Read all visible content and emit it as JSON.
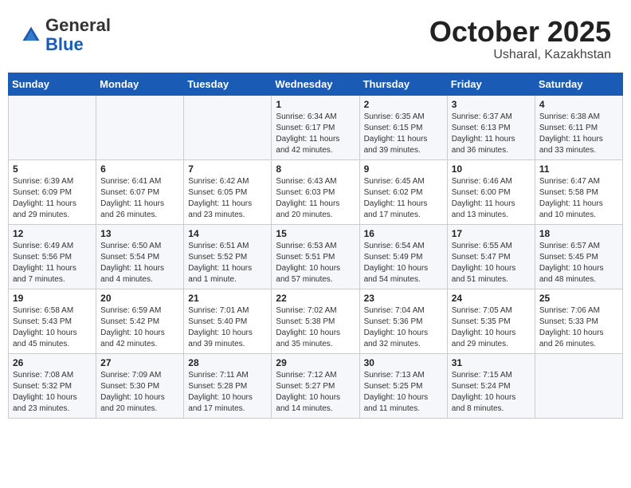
{
  "header": {
    "logo_line1": "General",
    "logo_line2": "Blue",
    "month": "October 2025",
    "location": "Usharal, Kazakhstan"
  },
  "weekdays": [
    "Sunday",
    "Monday",
    "Tuesday",
    "Wednesday",
    "Thursday",
    "Friday",
    "Saturday"
  ],
  "weeks": [
    [
      {
        "day": "",
        "content": ""
      },
      {
        "day": "",
        "content": ""
      },
      {
        "day": "",
        "content": ""
      },
      {
        "day": "1",
        "content": "Sunrise: 6:34 AM\nSunset: 6:17 PM\nDaylight: 11 hours\nand 42 minutes."
      },
      {
        "day": "2",
        "content": "Sunrise: 6:35 AM\nSunset: 6:15 PM\nDaylight: 11 hours\nand 39 minutes."
      },
      {
        "day": "3",
        "content": "Sunrise: 6:37 AM\nSunset: 6:13 PM\nDaylight: 11 hours\nand 36 minutes."
      },
      {
        "day": "4",
        "content": "Sunrise: 6:38 AM\nSunset: 6:11 PM\nDaylight: 11 hours\nand 33 minutes."
      }
    ],
    [
      {
        "day": "5",
        "content": "Sunrise: 6:39 AM\nSunset: 6:09 PM\nDaylight: 11 hours\nand 29 minutes."
      },
      {
        "day": "6",
        "content": "Sunrise: 6:41 AM\nSunset: 6:07 PM\nDaylight: 11 hours\nand 26 minutes."
      },
      {
        "day": "7",
        "content": "Sunrise: 6:42 AM\nSunset: 6:05 PM\nDaylight: 11 hours\nand 23 minutes."
      },
      {
        "day": "8",
        "content": "Sunrise: 6:43 AM\nSunset: 6:03 PM\nDaylight: 11 hours\nand 20 minutes."
      },
      {
        "day": "9",
        "content": "Sunrise: 6:45 AM\nSunset: 6:02 PM\nDaylight: 11 hours\nand 17 minutes."
      },
      {
        "day": "10",
        "content": "Sunrise: 6:46 AM\nSunset: 6:00 PM\nDaylight: 11 hours\nand 13 minutes."
      },
      {
        "day": "11",
        "content": "Sunrise: 6:47 AM\nSunset: 5:58 PM\nDaylight: 11 hours\nand 10 minutes."
      }
    ],
    [
      {
        "day": "12",
        "content": "Sunrise: 6:49 AM\nSunset: 5:56 PM\nDaylight: 11 hours\nand 7 minutes."
      },
      {
        "day": "13",
        "content": "Sunrise: 6:50 AM\nSunset: 5:54 PM\nDaylight: 11 hours\nand 4 minutes."
      },
      {
        "day": "14",
        "content": "Sunrise: 6:51 AM\nSunset: 5:52 PM\nDaylight: 11 hours\nand 1 minute."
      },
      {
        "day": "15",
        "content": "Sunrise: 6:53 AM\nSunset: 5:51 PM\nDaylight: 10 hours\nand 57 minutes."
      },
      {
        "day": "16",
        "content": "Sunrise: 6:54 AM\nSunset: 5:49 PM\nDaylight: 10 hours\nand 54 minutes."
      },
      {
        "day": "17",
        "content": "Sunrise: 6:55 AM\nSunset: 5:47 PM\nDaylight: 10 hours\nand 51 minutes."
      },
      {
        "day": "18",
        "content": "Sunrise: 6:57 AM\nSunset: 5:45 PM\nDaylight: 10 hours\nand 48 minutes."
      }
    ],
    [
      {
        "day": "19",
        "content": "Sunrise: 6:58 AM\nSunset: 5:43 PM\nDaylight: 10 hours\nand 45 minutes."
      },
      {
        "day": "20",
        "content": "Sunrise: 6:59 AM\nSunset: 5:42 PM\nDaylight: 10 hours\nand 42 minutes."
      },
      {
        "day": "21",
        "content": "Sunrise: 7:01 AM\nSunset: 5:40 PM\nDaylight: 10 hours\nand 39 minutes."
      },
      {
        "day": "22",
        "content": "Sunrise: 7:02 AM\nSunset: 5:38 PM\nDaylight: 10 hours\nand 35 minutes."
      },
      {
        "day": "23",
        "content": "Sunrise: 7:04 AM\nSunset: 5:36 PM\nDaylight: 10 hours\nand 32 minutes."
      },
      {
        "day": "24",
        "content": "Sunrise: 7:05 AM\nSunset: 5:35 PM\nDaylight: 10 hours\nand 29 minutes."
      },
      {
        "day": "25",
        "content": "Sunrise: 7:06 AM\nSunset: 5:33 PM\nDaylight: 10 hours\nand 26 minutes."
      }
    ],
    [
      {
        "day": "26",
        "content": "Sunrise: 7:08 AM\nSunset: 5:32 PM\nDaylight: 10 hours\nand 23 minutes."
      },
      {
        "day": "27",
        "content": "Sunrise: 7:09 AM\nSunset: 5:30 PM\nDaylight: 10 hours\nand 20 minutes."
      },
      {
        "day": "28",
        "content": "Sunrise: 7:11 AM\nSunset: 5:28 PM\nDaylight: 10 hours\nand 17 minutes."
      },
      {
        "day": "29",
        "content": "Sunrise: 7:12 AM\nSunset: 5:27 PM\nDaylight: 10 hours\nand 14 minutes."
      },
      {
        "day": "30",
        "content": "Sunrise: 7:13 AM\nSunset: 5:25 PM\nDaylight: 10 hours\nand 11 minutes."
      },
      {
        "day": "31",
        "content": "Sunrise: 7:15 AM\nSunset: 5:24 PM\nDaylight: 10 hours\nand 8 minutes."
      },
      {
        "day": "",
        "content": ""
      }
    ]
  ]
}
